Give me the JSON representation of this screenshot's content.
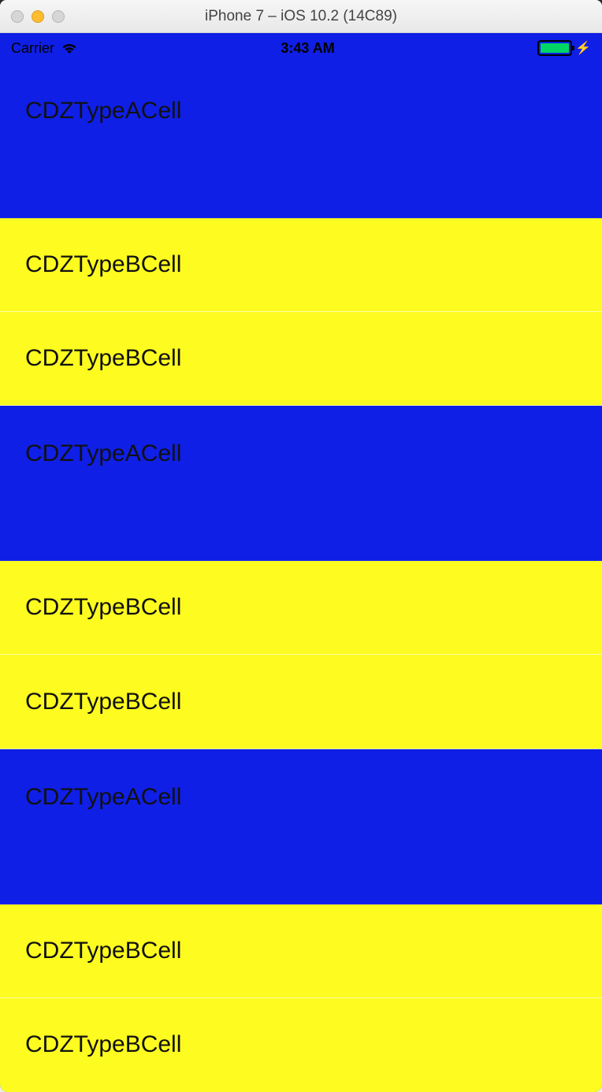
{
  "window": {
    "title": "iPhone 7 – iOS 10.2 (14C89)"
  },
  "statusBar": {
    "carrier": "Carrier",
    "time": "3:43 AM"
  },
  "cells": [
    {
      "type": "a",
      "label": "CDZTypeACell"
    },
    {
      "type": "b",
      "label": "CDZTypeBCell"
    },
    {
      "type": "b",
      "label": "CDZTypeBCell"
    },
    {
      "type": "a",
      "label": "CDZTypeACell"
    },
    {
      "type": "b",
      "label": "CDZTypeBCell"
    },
    {
      "type": "b",
      "label": "CDZTypeBCell"
    },
    {
      "type": "a",
      "label": "CDZTypeACell"
    },
    {
      "type": "b",
      "label": "CDZTypeBCell"
    },
    {
      "type": "b",
      "label": "CDZTypeBCell"
    }
  ],
  "colors": {
    "cellA": "#0f1fe6",
    "cellB": "#fdfb1f",
    "batteryFill": "#00d566"
  }
}
